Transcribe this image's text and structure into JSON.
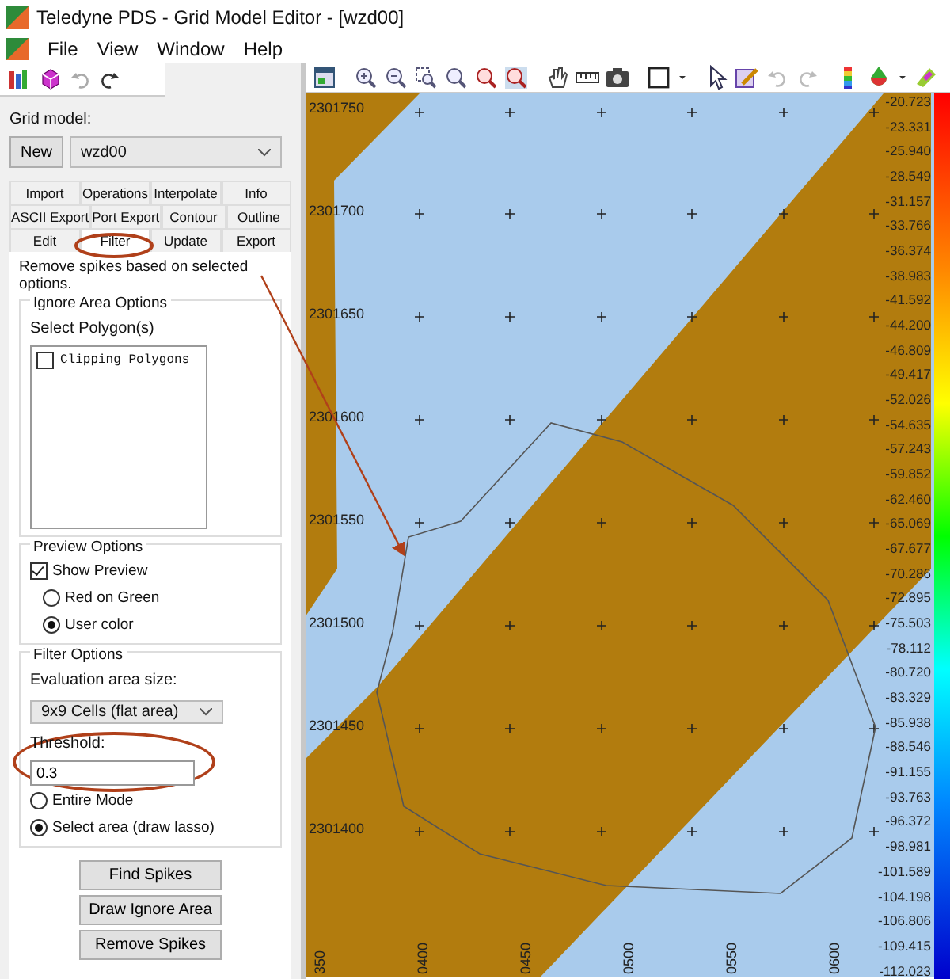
{
  "window": {
    "title": "Teledyne PDS - Grid Model Editor - [wzd00]"
  },
  "menu": [
    "File",
    "View",
    "Window",
    "Help"
  ],
  "panel": {
    "grid_model_label": "Grid model:",
    "new_button": "New",
    "model_select": "wzd00",
    "tab_rows": [
      [
        {
          "label": "Import",
          "selected": false
        },
        {
          "label": "Operations",
          "selected": false
        },
        {
          "label": "Interpolate",
          "selected": false
        },
        {
          "label": "Info",
          "selected": false
        }
      ],
      [
        {
          "label": "ASCII Export",
          "selected": false
        },
        {
          "label": "Port Export",
          "selected": false
        },
        {
          "label": "Contour",
          "selected": false
        },
        {
          "label": "Outline",
          "selected": false
        }
      ],
      [
        {
          "label": "Edit",
          "selected": false
        },
        {
          "label": "Filter",
          "selected": true
        },
        {
          "label": "Update",
          "selected": false
        },
        {
          "label": "Export",
          "selected": false
        }
      ]
    ],
    "description": "Remove spikes based on selected options.",
    "ignore_area": {
      "title": "Ignore Area Options",
      "select_label": "Select Polygon(s)",
      "polygons": [
        {
          "label": "Clipping Polygons",
          "checked": false
        }
      ]
    },
    "preview": {
      "title": "Preview Options",
      "show_preview": {
        "label": "Show Preview",
        "checked": true
      },
      "radios": [
        {
          "label": "Red on Green",
          "selected": false
        },
        {
          "label": "User color",
          "selected": true
        }
      ]
    },
    "filter": {
      "title": "Filter Options",
      "area_label": "Evaluation area size:",
      "area_select": "9x9 Cells (flat area)",
      "threshold_label": "Threshold:",
      "threshold": "0.3",
      "radios": [
        {
          "label": "Entire Mode",
          "selected": false
        },
        {
          "label": "Select area (draw lasso)",
          "selected": true
        }
      ]
    },
    "buttons": [
      "Find Spikes",
      "Draw Ignore Area",
      "Remove Spikes"
    ]
  },
  "map": {
    "y_labels": [
      "2301750",
      "2301700",
      "2301650",
      "2301600",
      "2301550",
      "2301500",
      "2301450",
      "2301400"
    ],
    "x_labels": [
      "350",
      "0400",
      "0450",
      "0500",
      "0550",
      "0600"
    ],
    "legend": [
      "-20.723",
      "-23.331",
      "-25.940",
      "-28.549",
      "-31.157",
      "-33.766",
      "-36.374",
      "-38.983",
      "-41.592",
      "-44.200",
      "-46.809",
      "-49.417",
      "-52.026",
      "-54.635",
      "-57.243",
      "-59.852",
      "-62.460",
      "-65.069",
      "-67.677",
      "-70.286",
      "-72.895",
      "-75.503",
      "-78.112",
      "-80.720",
      "-83.329",
      "-85.938",
      "-88.546",
      "-91.155",
      "-93.763",
      "-96.372",
      "-98.981",
      "-101.589",
      "-104.198",
      "-106.806",
      "-109.415",
      "-112.023"
    ]
  }
}
